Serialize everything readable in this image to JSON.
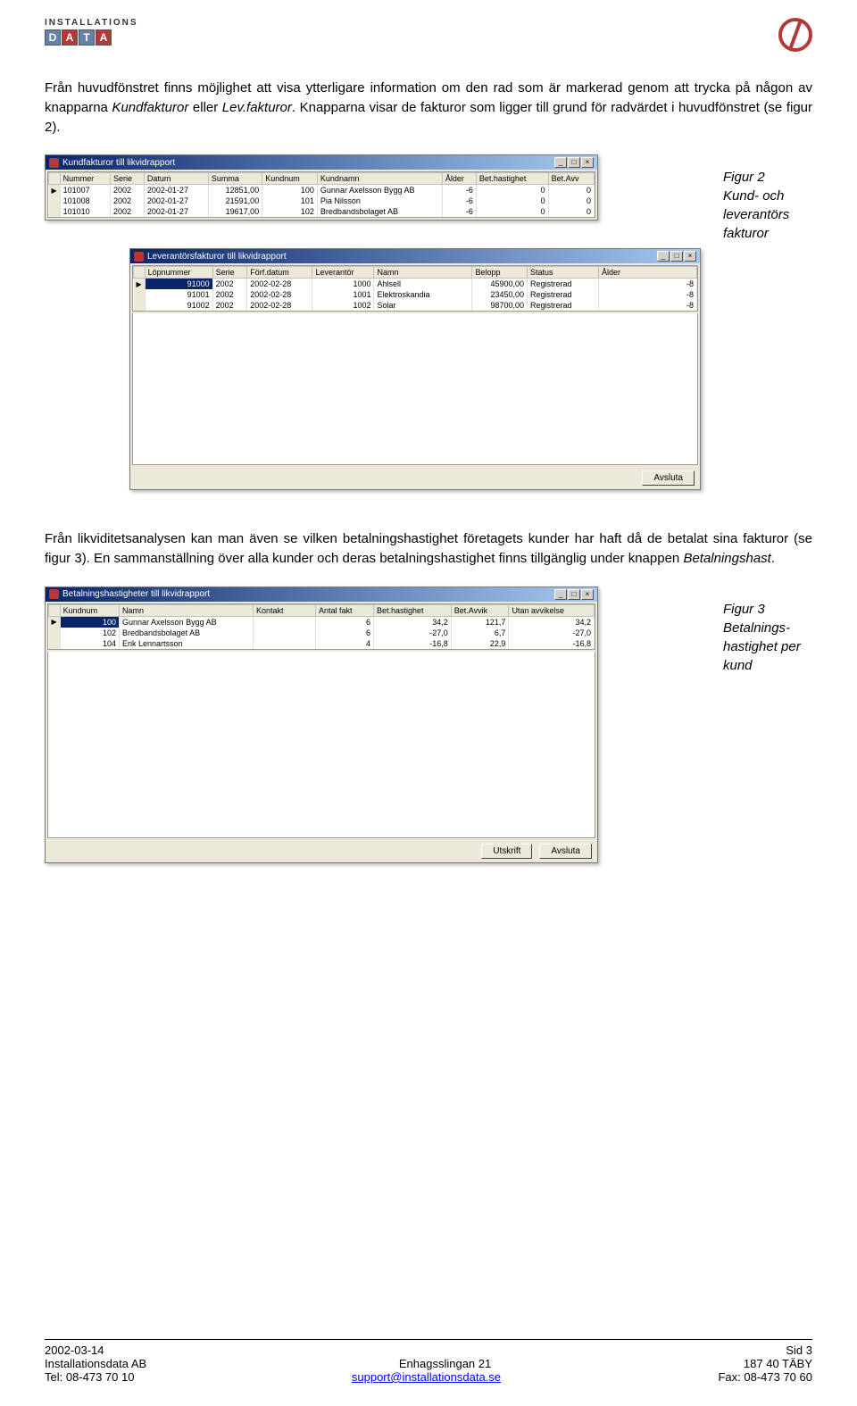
{
  "header": {
    "logo_text_top": "INSTALLATIONS",
    "logo_letters": [
      "D",
      "A",
      "T",
      "A"
    ]
  },
  "para1": "Från huvudfönstret finns möjlighet att visa ytterligare information om den rad som är markerad genom att trycka på någon av knapparna ",
  "para1_i1": "Kundfakturor",
  "para1_mid": " eller ",
  "para1_i2": "Lev.fakturor",
  "para1_end": ". Knapparna visar de fakturor som ligger till grund för radvärdet i huvudfönstret (se figur 2).",
  "fig2_caption_a": "Figur 2",
  "fig2_caption_b": "Kund- och leverantörs fakturor",
  "win1": {
    "title": "Kundfakturor till likvidrapport",
    "cols": [
      "Nummer",
      "Serie",
      "Datum",
      "Summa",
      "Kundnum",
      "Kundnamn",
      "Ålder",
      "Bet.hastighet",
      "Bet.Avv"
    ],
    "rows": [
      [
        "101007",
        "2002",
        "2002-01-27",
        "12851,00",
        "100",
        "Gunnar Axelsson Bygg AB",
        "-6",
        "0",
        "0"
      ],
      [
        "101008",
        "2002",
        "2002-01-27",
        "21591,00",
        "101",
        "Pia Nilsson",
        "-6",
        "0",
        "0"
      ],
      [
        "101010",
        "2002",
        "2002-01-27",
        "19617,00",
        "102",
        "Bredbandsbolaget AB",
        "-6",
        "0",
        "0"
      ]
    ]
  },
  "win2": {
    "title": "Leverantörsfakturor till likvidrapport",
    "cols": [
      "Löpnummer",
      "Serie",
      "Förf.datum",
      "Leverantör",
      "Namn",
      "Belopp",
      "Status",
      "Ålder"
    ],
    "rows": [
      [
        "91000",
        "2002",
        "2002-02-28",
        "1000",
        "Ahlsell",
        "45900,00",
        "Registrerad",
        "-8"
      ],
      [
        "91001",
        "2002",
        "2002-02-28",
        "1001",
        "Elektroskandia",
        "23450,00",
        "Registrerad",
        "-8"
      ],
      [
        "91002",
        "2002",
        "2002-02-28",
        "1002",
        "Solar",
        "98700,00",
        "Registrerad",
        "-8"
      ]
    ],
    "button": "Avsluta"
  },
  "para2_a": "Från likviditetsanalysen kan man även se vilken betalningshastighet företagets kunder har haft då de betalat sina fakturor (se figur 3). En sammanställning över alla kunder och deras betalningshastighet finns tillgänglig under knappen ",
  "para2_i": "Betalningshast",
  "para2_b": ".",
  "fig3_caption_a": "Figur 3",
  "fig3_caption_b": "Betalnings-hastighet per kund",
  "win3": {
    "title": "Betalningshastigheter till likvidrapport",
    "cols": [
      "Kundnum",
      "Namn",
      "Kontakt",
      "Antal fakt",
      "Bet.hastighet",
      "Bet.Avvik",
      "Utan avvikelse"
    ],
    "rows": [
      [
        "100",
        "Gunnar Axelsson Bygg AB",
        "",
        "6",
        "34,2",
        "121,7",
        "34,2"
      ],
      [
        "102",
        "Bredbandsbolaget AB",
        "",
        "6",
        "-27,0",
        "6,7",
        "-27,0"
      ],
      [
        "104",
        "Erik Lennartsson",
        "",
        "4",
        "-16,8",
        "22,9",
        "-16,8"
      ]
    ],
    "button1": "Utskrift",
    "button2": "Avsluta"
  },
  "footer": {
    "r1l": "2002-03-14",
    "r1r": "Sid 3",
    "r2l": "Installationsdata AB",
    "r2c": "Enhagsslingan 21",
    "r2r": "187 40  TÄBY",
    "r3l": "Tel: 08-473 70 10",
    "r3c": "support@installationsdata.se",
    "r3r": "Fax: 08-473 70 60"
  }
}
